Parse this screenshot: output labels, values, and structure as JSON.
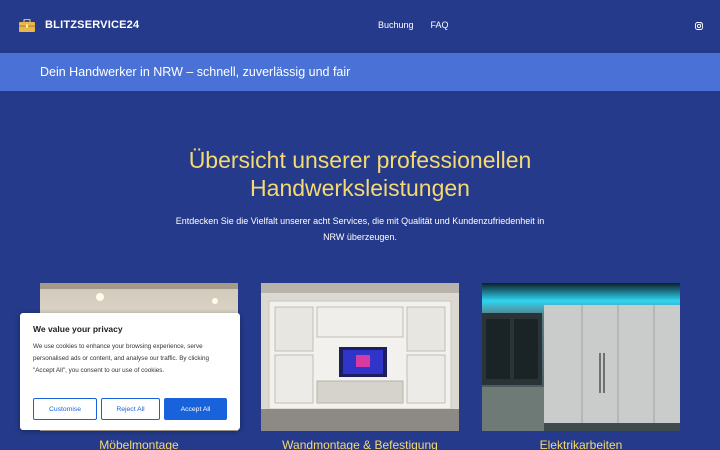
{
  "header": {
    "brand": "BLITZSERVICE24",
    "nav": [
      {
        "label": "Buchung"
      },
      {
        "label": "FAQ"
      }
    ],
    "logo_icon": "toolbox-icon",
    "social_icon": "instagram-icon"
  },
  "banner": {
    "text": "Dein Handwerker in NRW – schnell, zuverlässig und fair"
  },
  "hero": {
    "title_line1": "Übersicht unserer professionellen",
    "title_line2": "Handwerksleistungen",
    "subtitle_line1": "Entdecken Sie die Vielfalt unserer acht Services, die mit Qualität und Kundenzufriedenheit in",
    "subtitle_line2": "NRW überzeugen."
  },
  "services": [
    {
      "title": "Möbelmontage"
    },
    {
      "title": "Wandmontage & Befestigung"
    },
    {
      "title": "Elektrikarbeiten"
    }
  ],
  "cookie_banner": {
    "title": "We value your privacy",
    "text": "We use cookies to enhance your browsing experience, serve personalised ads or content, and analyse our traffic. By clicking \"Accept All\", you consent to our use of cookies.",
    "customise_label": "Customise",
    "reject_label": "Reject All",
    "accept_label": "Accept All"
  },
  "colors": {
    "background": "#253a8a",
    "banner": "#4a72d6",
    "accent_yellow": "#f5d972",
    "cookie_button": "#1863dc"
  }
}
